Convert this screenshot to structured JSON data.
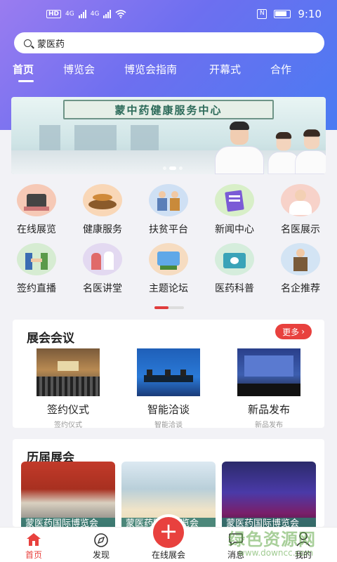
{
  "status_bar": {
    "network": "HD",
    "signal1": "4G",
    "signal2": "4G",
    "nfc": "N",
    "time": "9:10"
  },
  "search": {
    "value": "蒙医药"
  },
  "tabs": [
    {
      "label": "首页",
      "active": true
    },
    {
      "label": "博览会"
    },
    {
      "label": "博览会指南"
    },
    {
      "label": "开幕式"
    },
    {
      "label": "合作"
    }
  ],
  "banner": {
    "title": "蒙中药健康服务中心",
    "slide_count": 3,
    "current_slide": 1
  },
  "categories": [
    {
      "label": "在线展览",
      "icon": "exhibition-hall-icon",
      "color": "#f6c9b6"
    },
    {
      "label": "健康服务",
      "icon": "herbal-medicine-icon",
      "color": "#f9d7b7"
    },
    {
      "label": "扶贫平台",
      "icon": "farmers-icon",
      "color": "#cfe0f4"
    },
    {
      "label": "新闻中心",
      "icon": "news-icon",
      "color": "#d8efc8"
    },
    {
      "label": "名医展示",
      "icon": "doctor-icon",
      "color": "#f7d2c9"
    },
    {
      "label": "签约直播",
      "icon": "handshake-icon",
      "color": "#d6ecd2"
    },
    {
      "label": "名医讲堂",
      "icon": "lecture-icon",
      "color": "#e3d9f1"
    },
    {
      "label": "主题论坛",
      "icon": "forum-icon",
      "color": "#f6dcc1"
    },
    {
      "label": "医药科普",
      "icon": "science-icon",
      "color": "#d5eddc"
    },
    {
      "label": "名企推荐",
      "icon": "enterprise-icon",
      "color": "#d3e4f4"
    }
  ],
  "pager": {
    "pages": 2,
    "current": 1
  },
  "expo_section": {
    "title": "展会会议",
    "more_label": "更多",
    "items": [
      {
        "title": "签约仪式",
        "subtitle": "签约仪式"
      },
      {
        "title": "智能洽谈",
        "subtitle": "智能洽谈"
      },
      {
        "title": "新品发布",
        "subtitle": "新品发布"
      }
    ]
  },
  "past_section": {
    "title": "历届展会",
    "items": [
      {
        "caption": "蒙医药国际博览会"
      },
      {
        "caption": "蒙医药国际博览会"
      },
      {
        "caption": "蒙医药国际博览会"
      }
    ]
  },
  "bottom_nav": {
    "items": [
      {
        "label": "首页",
        "active": true
      },
      {
        "label": "发现"
      },
      {
        "label": "在线展会"
      },
      {
        "label": "消息"
      },
      {
        "label": "我的"
      }
    ]
  },
  "watermark": {
    "text": "绿色资源网",
    "url": "www.downcc.com"
  },
  "colors": {
    "accent": "#e8413e",
    "header_start": "#9a7cf0",
    "header_end": "#4a7bf2"
  }
}
